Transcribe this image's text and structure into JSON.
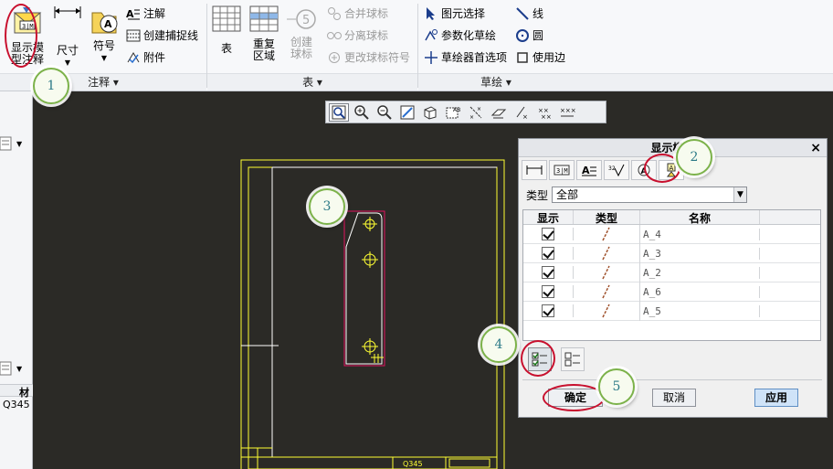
{
  "ribbon": {
    "annotate_group": {
      "label": "注释",
      "show_model_annotations": "显示模型注释",
      "dimension": "尺寸",
      "symbol": "符号",
      "note": "注解",
      "create_snap_line": "创建捕捉线",
      "attachment": "附件"
    },
    "table_group": {
      "label": "表",
      "table": "表",
      "repeat_region": "重复区域",
      "create_balloon": "创建球标",
      "merge_balloon": "合并球标",
      "separate_balloon": "分离球标",
      "change_balloon_symbol": "更改球标符号"
    },
    "sketch_group": {
      "label": "草绘",
      "select_element": "图元选择",
      "parametric_sketch": "参数化草绘",
      "sketcher_prefs": "草绘器首选项",
      "line": "线",
      "circle": "圆",
      "use_edge": "使用边"
    }
  },
  "left_strip": {
    "material_header": "材",
    "material_value": "Q345"
  },
  "drawing": {
    "title_block_material": "Q345"
  },
  "dialog": {
    "title": "显示模型",
    "type_label": "类型",
    "type_value": "全部",
    "columns": [
      "显示",
      "类型",
      "名称"
    ],
    "rows": [
      {
        "show": true,
        "name": "A_4"
      },
      {
        "show": true,
        "name": "A_3"
      },
      {
        "show": true,
        "name": "A_2"
      },
      {
        "show": true,
        "name": "A_6"
      },
      {
        "show": true,
        "name": "A_5"
      }
    ],
    "ok": "确定",
    "cancel": "取消",
    "apply": "应用"
  },
  "callouts": [
    "1",
    "2",
    "3",
    "4",
    "5"
  ],
  "colors": {
    "canvas": "#2b2a26",
    "drawing_line": "#ffff00",
    "highlight": "#c8102e",
    "callout_border": "#7cb24a",
    "apply_button": "#cfe3f8"
  }
}
